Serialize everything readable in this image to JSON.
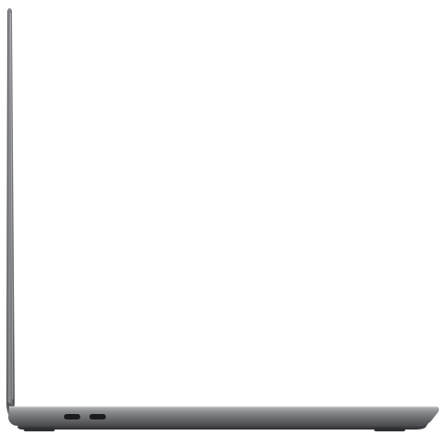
{
  "image": {
    "subject": "laptop-side-profile",
    "background_color": "#ffffff",
    "body_color": "#6f7073",
    "body_highlight": "#a7a9ad",
    "body_shadow": "#3a3b3e",
    "port_color": "#1c1c1e",
    "foot_color": "#2f3033",
    "ports": [
      "usb-c-port",
      "usb-c-port"
    ]
  }
}
